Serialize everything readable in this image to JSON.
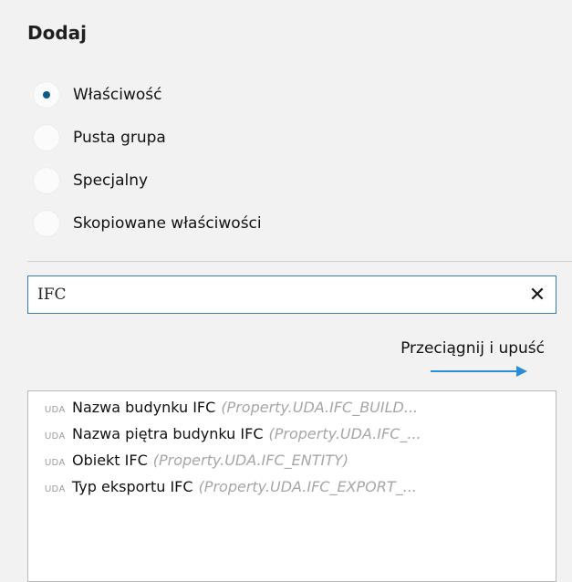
{
  "section_title": "Dodaj",
  "radio_options": [
    {
      "label": "Właściwość",
      "selected": true
    },
    {
      "label": "Pusta grupa",
      "selected": false
    },
    {
      "label": "Specjalny",
      "selected": false
    },
    {
      "label": "Skopiowane właściwości",
      "selected": false
    }
  ],
  "search": {
    "value": "IFC",
    "clear_icon": "close-icon"
  },
  "drag_drop": {
    "label": "Przeciągnij i upuść",
    "icon": "arrow-right-icon",
    "arrow_color": "#2a8dd6"
  },
  "list": {
    "items": [
      {
        "tag": "UDA",
        "name": "Nazwa budynku IFC",
        "path": "(Property.UDA.IFC_BUILD..."
      },
      {
        "tag": "UDA",
        "name": "Nazwa piętra budynku IFC",
        "path": "(Property.UDA.IFC_..."
      },
      {
        "tag": "UDA",
        "name": "Obiekt IFC",
        "path": "(Property.UDA.IFC_ENTITY)"
      },
      {
        "tag": "UDA",
        "name": "Typ eksportu IFC",
        "path": "(Property.UDA.IFC_EXPORT_..."
      }
    ]
  },
  "colors": {
    "accent": "#0e5a8a",
    "search_border": "#3a7bbf",
    "muted": "#a6a6a6"
  }
}
